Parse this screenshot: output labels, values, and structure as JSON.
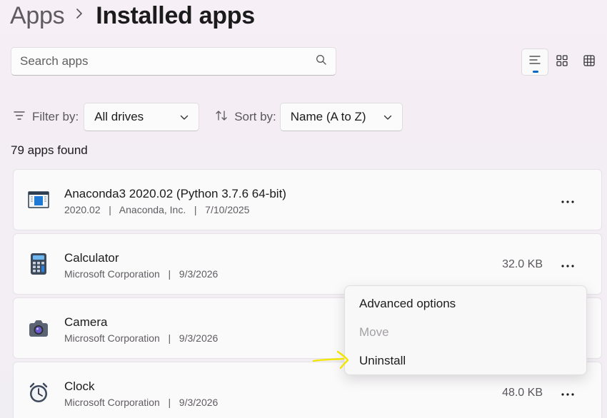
{
  "breadcrumb": {
    "parent": "Apps",
    "current": "Installed apps"
  },
  "search": {
    "placeholder": "Search apps"
  },
  "filter": {
    "label": "Filter by:",
    "value": "All drives"
  },
  "sort": {
    "label": "Sort by:",
    "value": "Name (A to Z)"
  },
  "count_text": "79 apps found",
  "apps": [
    {
      "name": "Anaconda3 2020.02 (Python 3.7.6 64-bit)",
      "meta": "2020.02   |   Anaconda, Inc.   |   7/10/2025",
      "size": ""
    },
    {
      "name": "Calculator",
      "meta": "Microsoft Corporation   |   9/3/2026",
      "size": "32.0 KB"
    },
    {
      "name": "Camera",
      "meta": "Microsoft Corporation   |   9/3/2026",
      "size": ""
    },
    {
      "name": "Clock",
      "meta": "Microsoft Corporation   |   9/3/2026",
      "size": "48.0 KB"
    }
  ],
  "context_menu": {
    "items": [
      {
        "label": "Advanced options",
        "enabled": true
      },
      {
        "label": "Move",
        "enabled": false
      },
      {
        "label": "Uninstall",
        "enabled": true
      }
    ]
  },
  "colors": {
    "accent": "#0067c0",
    "annotation": "#f2e500"
  }
}
